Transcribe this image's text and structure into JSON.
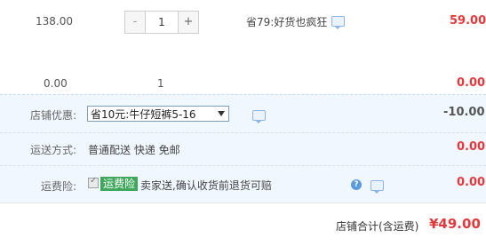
{
  "item": {
    "price": "138.00",
    "quantity": "1",
    "discount_text": "省79:好货也疯狂",
    "subtotal": "59.00",
    "minus_label": "-",
    "plus_label": "+"
  },
  "sum_row": {
    "price": "0.00",
    "quantity": "1",
    "subtotal": "0.00"
  },
  "shop_discount": {
    "label": "店铺优惠:",
    "selected": "省10元:牛仔短裤5-16",
    "amount": "-10.00"
  },
  "shipping": {
    "label": "运送方式:",
    "value": "普通配送 快递 免邮",
    "amount": "0.00"
  },
  "insurance": {
    "label": "运费险:",
    "badge": "运费险",
    "text": "卖家送,确认收货前退货可赔",
    "amount": "0.00"
  },
  "total": {
    "label": "店铺合计(含运费)",
    "amount": "¥49.00"
  },
  "icons": {
    "chat": "chat-bubble-icon",
    "help": "question-icon",
    "dropdown": "chevron-down-icon"
  },
  "colors": {
    "accent_red": "#e4393c",
    "panel_blue": "#f1f7ff",
    "badge_green": "#3fa85d"
  }
}
